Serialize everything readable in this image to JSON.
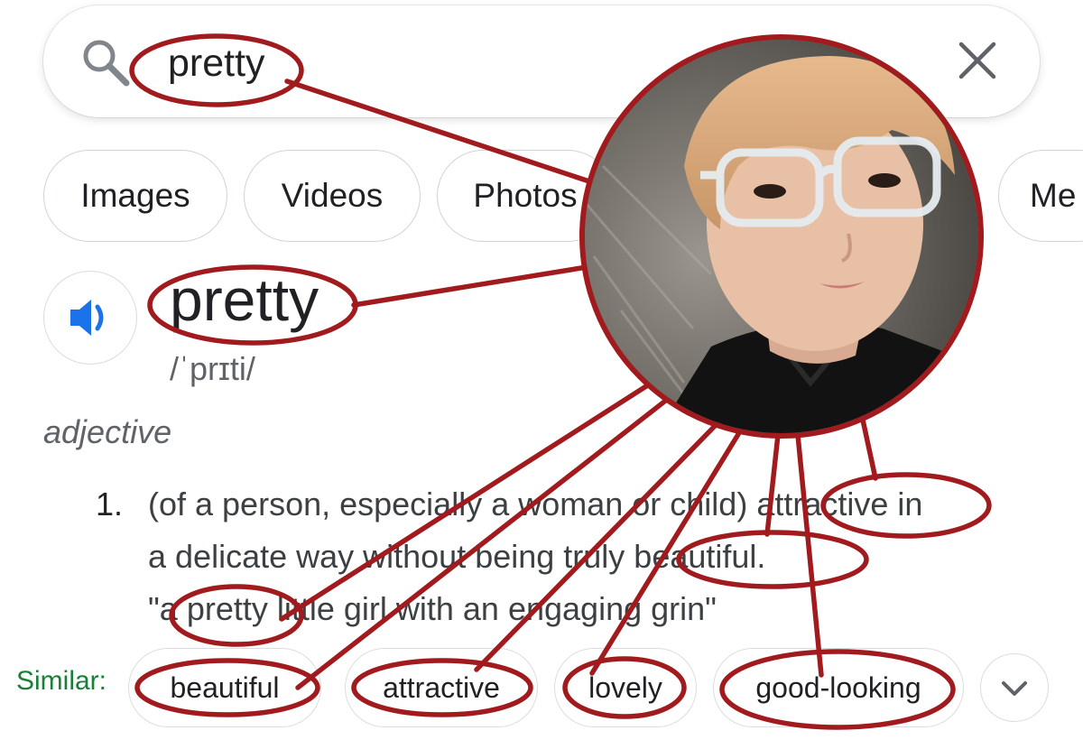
{
  "search": {
    "query": "pretty",
    "search_icon": "search-icon",
    "clear_icon": "close-icon"
  },
  "tabs": [
    {
      "label": "Images"
    },
    {
      "label": "Videos"
    },
    {
      "label": "Photos"
    },
    {
      "label": "Me"
    }
  ],
  "dictionary": {
    "speaker_icon": "speaker-icon",
    "word": "pretty",
    "pronunciation": "/ˈprɪti/",
    "part_of_speech": "adjective",
    "definition_number": "1.",
    "definition_line1_a": "(of a person, especially a woman or child) ",
    "definition_line1_b": "attractive",
    "definition_line1_c": " in",
    "definition_line2_a": "a delicate way without being truly ",
    "definition_line2_b": "beautiful.",
    "example_a": "\"a ",
    "example_b": "pretty",
    "example_c": " little girl with an engaging grin\""
  },
  "similar": {
    "label": "Similar:",
    "synonyms": [
      "beautiful",
      "attractive",
      "lovely",
      "good-looking"
    ],
    "expand_icon": "chevron-down-icon"
  },
  "overlay": {
    "annotation_color": "#a11a1d",
    "photo": "person-portrait-with-glasses"
  }
}
